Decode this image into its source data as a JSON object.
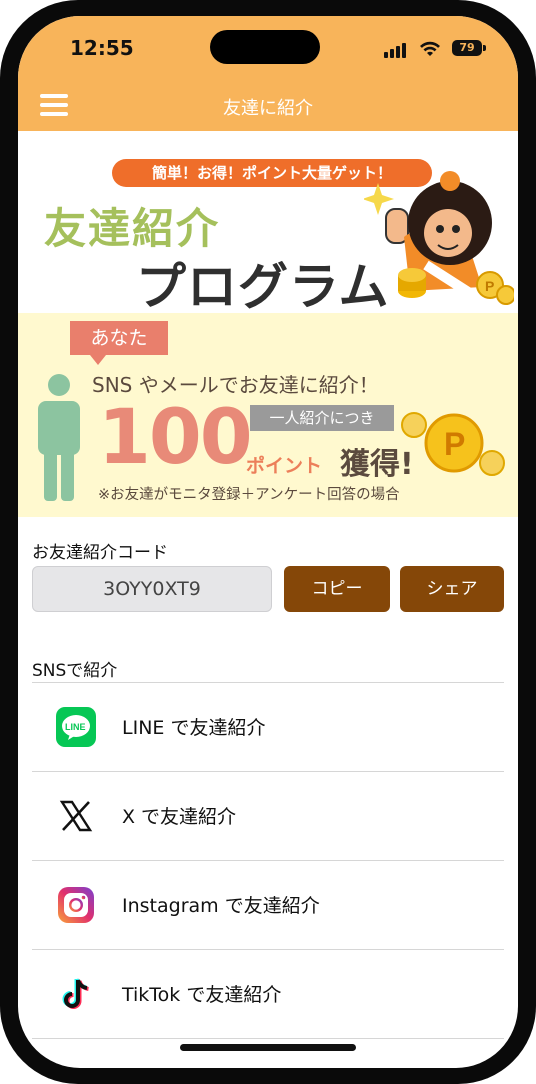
{
  "status_bar": {
    "time": "12:55",
    "battery": "79"
  },
  "header": {
    "title": "友達に紹介"
  },
  "banner": {
    "tagline": "簡単！お得！ポイント大量ゲット！",
    "title_line1": "友達紹介",
    "title_line2": "プログラム"
  },
  "promo": {
    "you_label": "あなた",
    "line1": "SNS やメールでお友達に紹介！",
    "amount": "100",
    "per_person": "一人紹介につき",
    "points_word": "ポイント",
    "acquire": "獲得!",
    "note": "※お友達がモニタ登録＋アンケート回答の場合"
  },
  "referral": {
    "label": "お友達紹介コード",
    "code": "3OYY0XT9",
    "copy_label": "コピー",
    "share_label": "シェア"
  },
  "sns": {
    "heading": "SNSで紹介",
    "items": [
      {
        "label": "LINE で友達紹介",
        "icon": "line-icon"
      },
      {
        "label": "X で友達紹介",
        "icon": "x-icon"
      },
      {
        "label": "Instagram で友達紹介",
        "icon": "instagram-icon"
      },
      {
        "label": "TikTok で友達紹介",
        "icon": "tiktok-icon"
      }
    ]
  },
  "colors": {
    "header_bg": "#f8b45a",
    "button_bg": "#854708",
    "promo_bg": "#fff9cf",
    "accent_orange": "#ef6e2a",
    "line_green": "#06c755"
  }
}
